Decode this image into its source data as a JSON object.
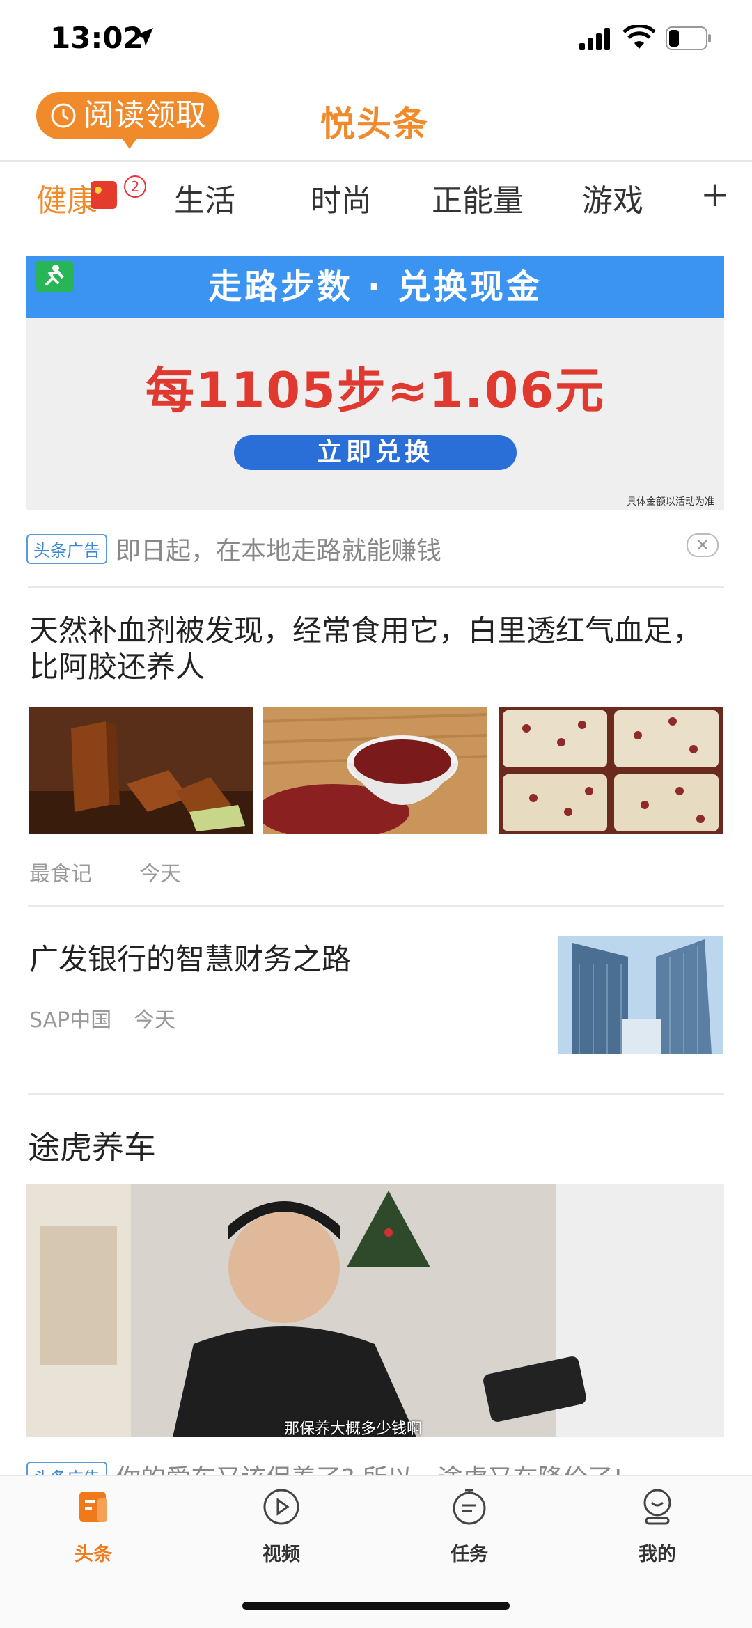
{
  "status_bar": {
    "time": "13:02"
  },
  "header": {
    "read_button_label": "阅读领取",
    "app_title": "悦头条"
  },
  "tabs": [
    {
      "label": "健康",
      "badge": "2"
    },
    {
      "label": "生活"
    },
    {
      "label": "时尚"
    },
    {
      "label": "正能量"
    },
    {
      "label": "游戏"
    }
  ],
  "tab_add_label": "+",
  "ad1": {
    "banner_title": "走路步数 · 兑换现金",
    "banner_main": "每1105步≈1.06元",
    "banner_button": "立即兑换",
    "banner_note": "具体金额以活动为准",
    "tag": "头条广告",
    "text": "即日起，在本地走路就能赚钱",
    "close": "✕"
  },
  "article1": {
    "title": "天然补血剂被发现，经常食用它，白里透红气血足，比阿胶还养人",
    "source": "最食记",
    "time": "今天"
  },
  "article2": {
    "title": "广发银行的智慧财务之路",
    "source": "SAP中国",
    "time": "今天"
  },
  "article3": {
    "title": "途虎养车",
    "video_caption": "那保养大概多少钱啊",
    "tag": "头条广告",
    "text": "你的爱车又该保养了? 所以，途虎又在降价了!",
    "close": "✕"
  },
  "bottom_nav": [
    {
      "label": "头条",
      "icon": "news-icon",
      "active": true
    },
    {
      "label": "视频",
      "icon": "play-icon"
    },
    {
      "label": "任务",
      "icon": "timer-icon"
    },
    {
      "label": "我的",
      "icon": "profile-icon"
    }
  ],
  "colors": {
    "accent": "#f08a2a",
    "ad_blue": "#3b93f2",
    "ad_red": "#e0392f"
  }
}
